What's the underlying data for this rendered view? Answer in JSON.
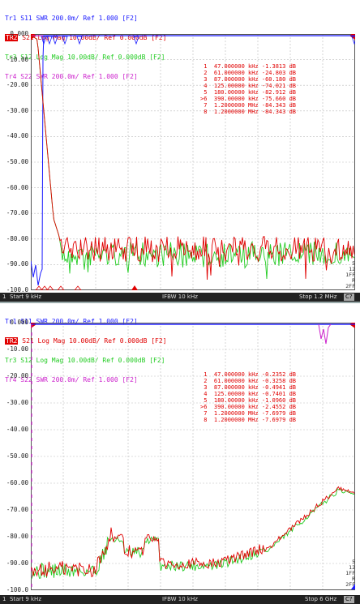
{
  "panels": [
    {
      "traces": [
        {
          "label": "Tr1 S11 SWR 200.0m/ Ref 1.000 [F2]",
          "color": "#1a1aff",
          "active": false
        },
        {
          "label": "S21 Log Mag 10.00dB/ Ref 0.000dB [F2]",
          "badge": "TR2",
          "color": "#e00000",
          "active": true
        },
        {
          "label": "Tr3 S12 Log Mag 10.00dB/ Ref 0.000dB [F2]",
          "color": "#22cc22",
          "active": false
        },
        {
          "label": "Tr4 S22 SWR 200.0m/ Ref 1.000 [F2]",
          "color": "#cc22cc",
          "active": false
        }
      ],
      "y_labels": [
        "0.000",
        "-10.00",
        "-20.00",
        "-30.00",
        "-40.00",
        "-50.00",
        "-60.00",
        "-70.00",
        "-80.00",
        "-90.00",
        "-100.0"
      ],
      "markers": [
        {
          "n": "1",
          "freq": "47.000000 kHz",
          "val": "-1.3813 dB"
        },
        {
          "n": "2",
          "freq": "61.000000 kHz",
          "val": "-24.803 dB"
        },
        {
          "n": "3",
          "freq": "87.000000 kHz",
          "val": "-60.180 dB"
        },
        {
          "n": "4",
          "freq": "125.00000 kHz",
          "val": "-74.021 dB"
        },
        {
          "n": "5",
          "freq": "180.00000 kHz",
          "val": "-82.912 dB"
        },
        {
          "n": ">6",
          "freq": "390.00000 kHz",
          "val": "-75.660 dB"
        },
        {
          "n": "7",
          "freq": "1.2000000 MHz",
          "val": "-84.343 dB"
        },
        {
          "n": "8",
          "freq": "1.2000000 MHz",
          "val": "-84.343 dB"
        }
      ],
      "right_info": [
        "5",
        "12",
        "1FF",
        "R",
        "2FF"
      ],
      "status": {
        "num": "1",
        "start": "Start 9 kHz",
        "ifbw": "IFBW 10 kHz",
        "stop": "Stop 1.2 MHz",
        "badge": "C?"
      }
    },
    {
      "traces": [
        {
          "label": "Tr1 S11 SWR 200.0m/ Ref 1.000 [F2]",
          "color": "#1a1aff",
          "active": false
        },
        {
          "label": "S21 Log Mag 10.00dB/ Ref 0.000dB [F2]",
          "badge": "TR2",
          "color": "#e00000",
          "active": true
        },
        {
          "label": "Tr3 S12 Log Mag 10.00dB/ Ref 0.000dB [F2]",
          "color": "#22cc22",
          "active": false
        },
        {
          "label": "Tr4 S22 SWR 200.0m/ Ref 1.000 [F2]",
          "color": "#cc22cc",
          "active": false
        }
      ],
      "y_labels": [
        "0.000",
        "-10.00",
        "-20.00",
        "-30.00",
        "-40.00",
        "-50.00",
        "-60.00",
        "-70.00",
        "-80.00",
        "-90.00",
        "-100.0"
      ],
      "markers": [
        {
          "n": "1",
          "freq": "47.000000 kHz",
          "val": "-0.2352 dB"
        },
        {
          "n": "2",
          "freq": "61.000000 kHz",
          "val": "-0.3258 dB"
        },
        {
          "n": "3",
          "freq": "87.000000 kHz",
          "val": "-0.4941 dB"
        },
        {
          "n": "4",
          "freq": "125.00000 kHz",
          "val": "-0.7401 dB"
        },
        {
          "n": "5",
          "freq": "180.00000 kHz",
          "val": "-1.0960 dB"
        },
        {
          "n": ">6",
          "freq": "390.00000 kHz",
          "val": "-2.4552 dB"
        },
        {
          "n": "7",
          "freq": "1.2000000 MHz",
          "val": "-7.6979 dB"
        },
        {
          "n": "8",
          "freq": "1.2000000 MHz",
          "val": "-7.6979 dB"
        }
      ],
      "right_info": [
        "5",
        "12",
        "1FF",
        "R",
        "2FF"
      ],
      "status": {
        "num": "1",
        "start": "Start 9 kHz",
        "ifbw": "IFBW 10 kHz",
        "stop": "Stop 6 GHz",
        "badge": "C?"
      }
    }
  ],
  "colors": {
    "s11": "#1a1aff",
    "s21": "#e00000",
    "s12": "#22cc22",
    "s22": "#cc22cc",
    "grid": "#aaaaaa",
    "ref": "#3333ff"
  }
}
